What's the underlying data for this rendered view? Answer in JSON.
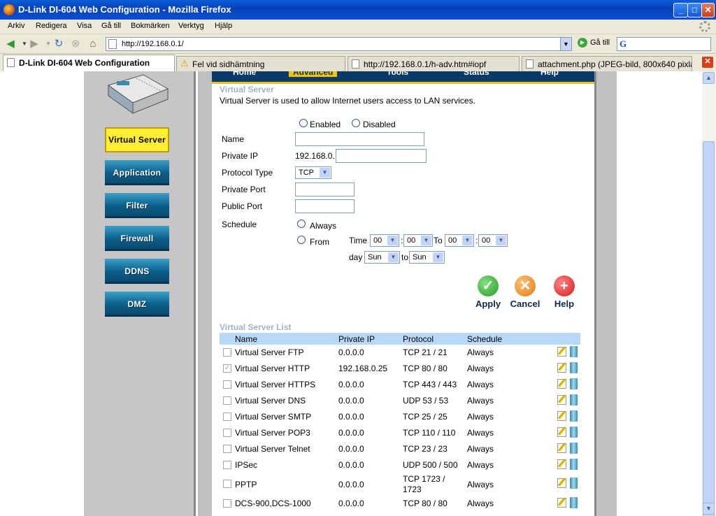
{
  "window": {
    "title": "D-Link DI-604 Web Configuration - Mozilla Firefox",
    "min": "_",
    "max": "□",
    "close": "✕"
  },
  "menu": [
    "Arkiv",
    "Redigera",
    "Visa",
    "Gå till",
    "Bokmärken",
    "Verktyg",
    "Hjälp"
  ],
  "toolbar": {
    "url": "http://192.168.0.1/",
    "go_label": "Gå till",
    "search_logo": "G"
  },
  "tabs": [
    {
      "label": "D-Link DI-604 Web Configuration",
      "active": true
    },
    {
      "label": "Fel vid sidhämtning",
      "active": false
    },
    {
      "label": "http://192.168.0.1/h-adv.htm#iopf",
      "active": false
    },
    {
      "label": "attachment.php (JPEG-bild, 800x640 pixlar)",
      "active": false
    }
  ],
  "sidebar": {
    "items": [
      {
        "label": "Virtual Server",
        "active": true
      },
      {
        "label": "Application",
        "active": false
      },
      {
        "label": "Filter",
        "active": false
      },
      {
        "label": "Firewall",
        "active": false
      },
      {
        "label": "DDNS",
        "active": false
      },
      {
        "label": "DMZ",
        "active": false
      }
    ]
  },
  "top_tabs": [
    "Home",
    "Advanced",
    "Tools",
    "Status",
    "Help"
  ],
  "form": {
    "title": "Virtual Server",
    "description": "Virtual Server is used to allow Internet users access to LAN services.",
    "enabled_label": "Enabled",
    "disabled_label": "Disabled",
    "name_label": "Name",
    "name_value": "",
    "private_ip_label": "Private IP",
    "private_ip_prefix": "192.168.0.",
    "private_ip_value": "",
    "protocol_label": "Protocol Type",
    "protocol_value": "TCP",
    "private_port_label": "Private Port",
    "public_port_label": "Public Port",
    "schedule_label": "Schedule",
    "always_label": "Always",
    "from_label": "From",
    "time_label": "Time",
    "to_label": "To",
    "day_label": "day",
    "to_lower": "to",
    "time_from_h": "00",
    "time_from_m": "00",
    "time_to_h": "00",
    "time_to_m": "00",
    "day_from": "Sun",
    "day_to": "Sun",
    "colon": ":"
  },
  "actions": {
    "apply": "Apply",
    "cancel": "Cancel",
    "help": "Help"
  },
  "list": {
    "title": "Virtual Server List",
    "columns": [
      "Name",
      "Private IP",
      "Protocol",
      "Schedule"
    ],
    "rows": [
      {
        "name": "Virtual Server FTP",
        "ip": "0.0.0.0",
        "protocol": "TCP 21 / 21",
        "schedule": "Always",
        "checked": false
      },
      {
        "name": "Virtual Server HTTP",
        "ip": "192.168.0.25",
        "protocol": "TCP 80 / 80",
        "schedule": "Always",
        "checked": true
      },
      {
        "name": "Virtual Server HTTPS",
        "ip": "0.0.0.0",
        "protocol": "TCP 443 / 443",
        "schedule": "Always",
        "checked": false
      },
      {
        "name": "Virtual Server DNS",
        "ip": "0.0.0.0",
        "protocol": "UDP 53 / 53",
        "schedule": "Always",
        "checked": false
      },
      {
        "name": "Virtual Server SMTP",
        "ip": "0.0.0.0",
        "protocol": "TCP 25 / 25",
        "schedule": "Always",
        "checked": false
      },
      {
        "name": "Virtual Server POP3",
        "ip": "0.0.0.0",
        "protocol": "TCP 110 / 110",
        "schedule": "Always",
        "checked": false
      },
      {
        "name": "Virtual Server Telnet",
        "ip": "0.0.0.0",
        "protocol": "TCP 23 / 23",
        "schedule": "Always",
        "checked": false
      },
      {
        "name": "IPSec",
        "ip": "0.0.0.0",
        "protocol": "UDP 500 / 500",
        "schedule": "Always",
        "checked": false
      },
      {
        "name": "PPTP",
        "ip": "0.0.0.0",
        "protocol": "TCP 1723 / 1723",
        "schedule": "Always",
        "checked": false
      },
      {
        "name": "DCS-900,DCS-1000",
        "ip": "0.0.0.0",
        "protocol": "TCP 80 / 80",
        "schedule": "Always",
        "checked": false
      }
    ]
  },
  "colors": {
    "title_bar": "#0842b8",
    "nav_button": "#0b5f8a",
    "nav_active": "#ffee33",
    "list_header": "#b8d8f8",
    "apply": "#2a9a2a",
    "cancel": "#e07a1a",
    "help": "#d02020"
  },
  "icons": {
    "back": "back-arrow-icon",
    "forward": "forward-arrow-icon",
    "reload": "reload-icon",
    "stop": "stop-icon",
    "home": "home-icon",
    "edit": "edit-icon",
    "delete": "trash-icon"
  }
}
